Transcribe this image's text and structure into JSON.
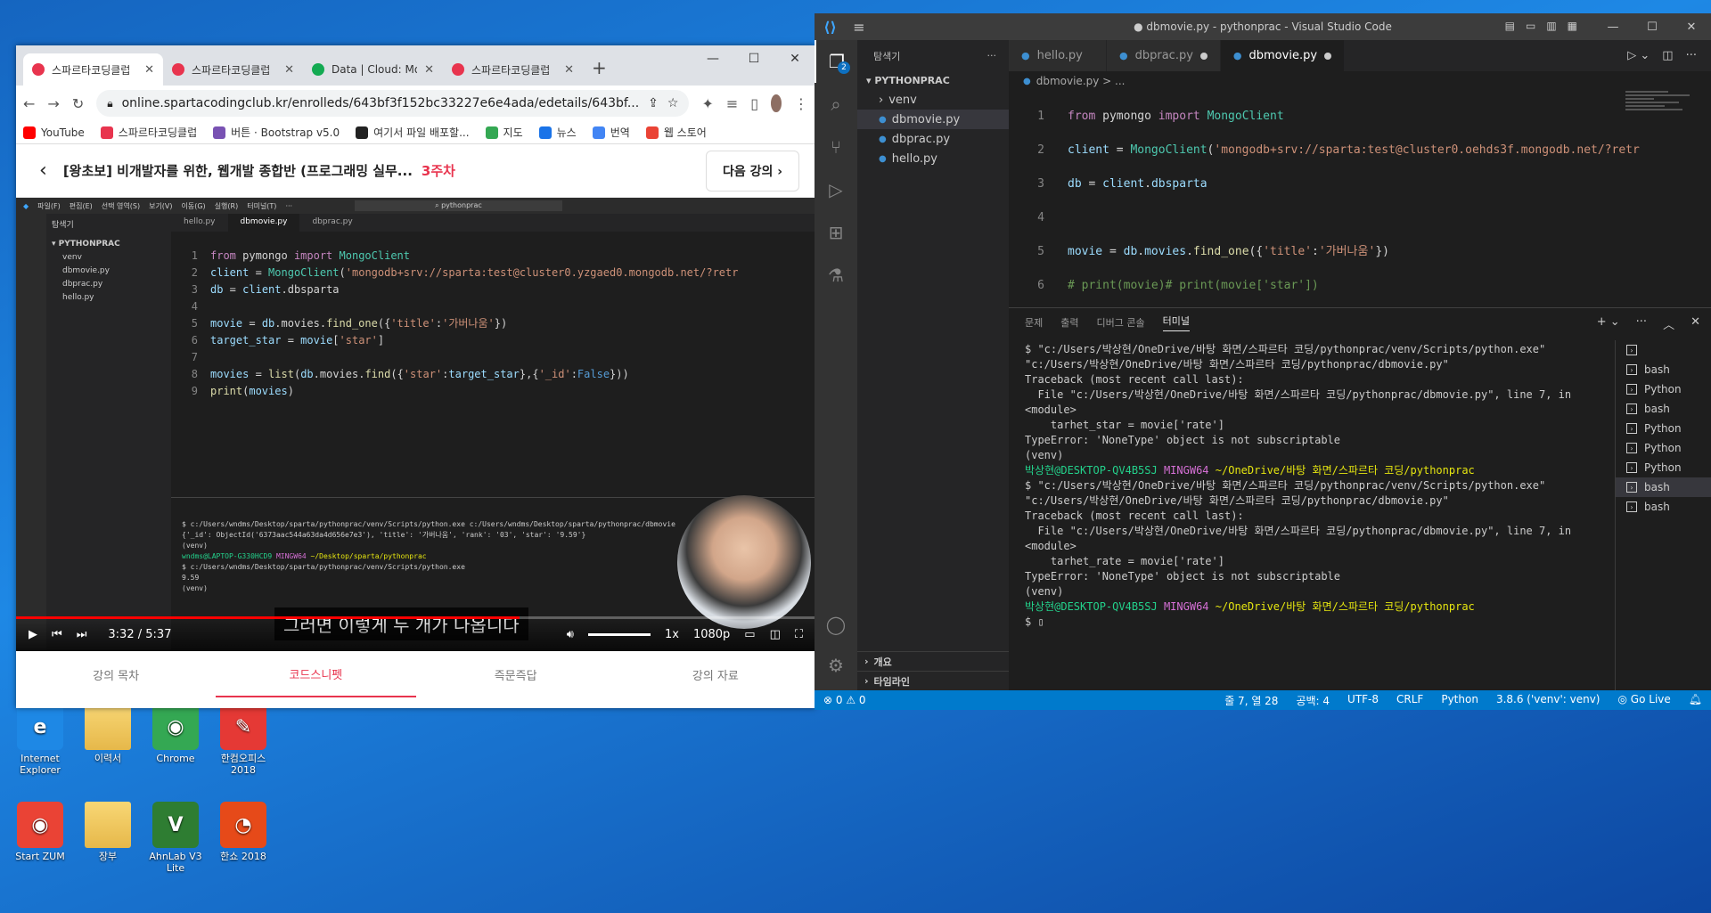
{
  "desktop": {
    "icons": [
      {
        "label": "Internet Explorer",
        "color": "#1e88e5",
        "glyph": "e"
      },
      {
        "label": "이력서",
        "color": "#f8d775",
        "glyph": ""
      },
      {
        "label": "Chrome",
        "color": "#34a853",
        "glyph": "◉"
      },
      {
        "label": "한컴오피스 2018",
        "color": "#e53935",
        "glyph": "✎"
      },
      {
        "label": "Start ZUM",
        "color": "#ea4335",
        "glyph": "◉"
      },
      {
        "label": "장부",
        "color": "#f8d775",
        "glyph": ""
      },
      {
        "label": "AhnLab V3 Lite",
        "color": "#2e7d32",
        "glyph": "V"
      },
      {
        "label": "한쇼 2018",
        "color": "#e64a19",
        "glyph": "◔"
      }
    ]
  },
  "chrome": {
    "tabs": [
      {
        "title": "스파르타코딩클럽",
        "color": "#e8344e"
      },
      {
        "title": "스파르타코딩클럽",
        "color": "#e8344e"
      },
      {
        "title": "Data | Cloud: Mo",
        "color": "#13aa52"
      },
      {
        "title": "스파르타코딩클럽",
        "color": "#e8344e"
      }
    ],
    "url": "online.spartacodingclub.kr/enrolleds/643bf3f152bc33227e6e4ada/edetails/643bf...",
    "bookmarks": [
      "YouTube",
      "스파르타코딩클럽",
      "버튼 · Bootstrap v5.0",
      "여기서 파일 배포할...",
      "지도",
      "뉴스",
      "번역",
      "웹 스토어"
    ],
    "course_title": "[왕초보] 비개발자를 위한, 웹개발 종합반 (프로그래밍 실무...",
    "week": "3주차",
    "next_lesson": "다음 강의",
    "video": {
      "subtitle": "그러면 이렇게 두 개가 나옵니다",
      "time_current": "3:32",
      "time_total": "5:37",
      "progress": 0.63,
      "speed": "1x",
      "quality": "1080p",
      "files": [
        "venv",
        "dbmovie.py",
        "dbprac.py",
        "hello.py"
      ],
      "tabs": [
        "hello.py",
        "dbmovie.py",
        "dbprac.py"
      ]
    },
    "course_tabs": [
      "강의 목차",
      "코드스니펫",
      "즉문즉답",
      "강의 자료"
    ]
  },
  "vscode": {
    "title": "● dbmovie.py - pythonprac - Visual Studio Code",
    "explorer_label": "탐색기",
    "project": "PYTHONPRAC",
    "files": [
      "venv",
      "dbmovie.py",
      "dbprac.py",
      "hello.py"
    ],
    "outline": "개요",
    "timeline": "타임라인",
    "tabs": [
      "hello.py",
      "dbprac.py",
      "dbmovie.py"
    ],
    "breadcrumb": "dbmovie.py > ...",
    "panel_tabs": [
      "문제",
      "출력",
      "디버그 콘솔",
      "터미널"
    ],
    "terminals": [
      "bash",
      "Python",
      "bash",
      "Python",
      "Python",
      "Python",
      "bash",
      "bash"
    ],
    "status": {
      "errors": "⊗ 0 ⚠ 0",
      "position": "줄 7, 열 28",
      "spaces": "공백: 4",
      "encoding": "UTF-8",
      "eol": "CRLF",
      "lang": "Python",
      "interp": "3.8.6 ('venv': venv)",
      "golive": "Go Live"
    }
  }
}
